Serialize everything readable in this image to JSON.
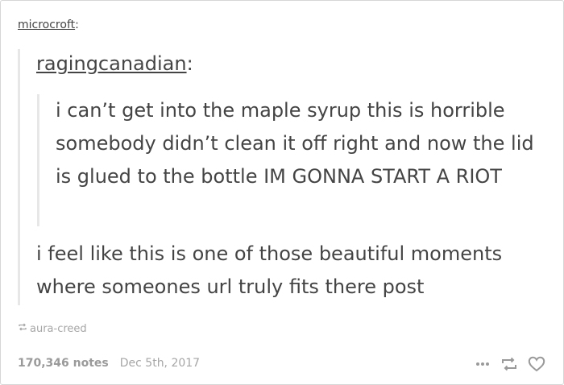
{
  "post": {
    "reblogger": "microcroft",
    "reblogger_suffix": ":",
    "parent_user": "ragingcanadian",
    "parent_suffix": ":",
    "original_text": "i can’t get into the maple syrup this is horrible somebody didn’t clean it off right and now the lid is glued to the bottle IM GONNA START A RIOT",
    "reply_text": "i feel like this is one of those beautiful moments where someones url truly fits there post"
  },
  "source": {
    "icon": "reblog-icon",
    "name": "aura-creed"
  },
  "footer": {
    "notes": "170,346 notes",
    "date": "Dec 5th, 2017"
  },
  "actions": {
    "more_icon": "more-icon",
    "reblog_icon": "reblog-icon",
    "like_icon": "heart-icon"
  },
  "colors": {
    "text": "#444444",
    "muted": "#a6a6a6",
    "border": "#d6d6d6",
    "quote_bar": "#e7e7e7"
  }
}
